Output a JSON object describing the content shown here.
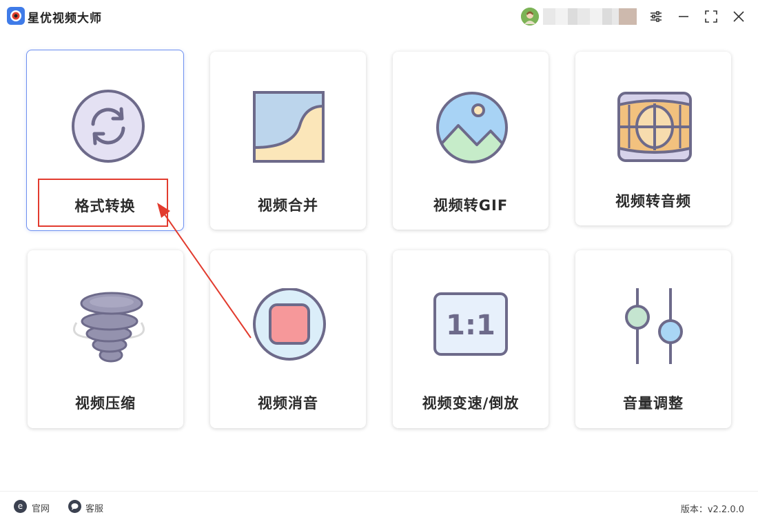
{
  "app": {
    "title": "星优视频大师"
  },
  "cards": [
    {
      "label": "格式转换",
      "icon": "format-convert-icon"
    },
    {
      "label": "视频合并",
      "icon": "video-merge-icon"
    },
    {
      "label": "视频转GIF",
      "icon": "video-to-gif-icon"
    },
    {
      "label": "视频转音频",
      "icon": "video-to-audio-icon"
    },
    {
      "label": "视频压缩",
      "icon": "video-compress-icon"
    },
    {
      "label": "视频消音",
      "icon": "video-mute-icon"
    },
    {
      "label": "视频变速/倒放",
      "icon": "video-speed-icon"
    },
    {
      "label": "音量调整",
      "icon": "volume-adjust-icon"
    }
  ],
  "footer": {
    "website": "官网",
    "support": "客服",
    "version": "版本：v2.2.0.0"
  },
  "colors": {
    "accent": "#3f7be8",
    "annotation": "#e23b2e",
    "icon_stroke": "#6d6a8a"
  }
}
